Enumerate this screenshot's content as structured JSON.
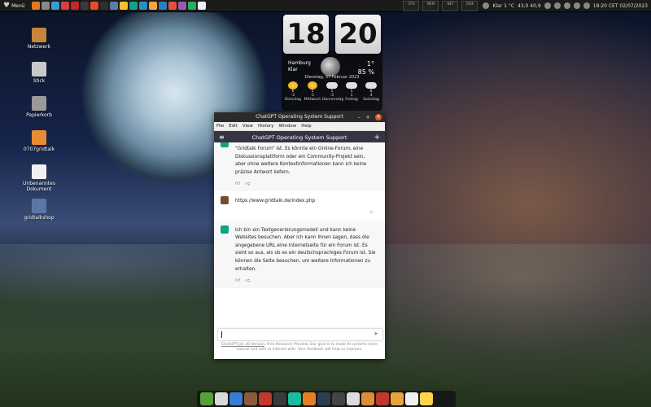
{
  "top_panel": {
    "menu_label": "Menü",
    "launcher_colors": [
      "#e07a23",
      "#888888",
      "#3a9ad9",
      "#d94040",
      "#c1272d",
      "#3a3a3a",
      "#e34b2a",
      "#303030",
      "#5b7fa6",
      "#f2c230",
      "#16a085",
      "#2c8fbf",
      "#f2a541",
      "#2980b9",
      "#e74c3c",
      "#9b59b6",
      "#27ae60",
      "#ecf0f1"
    ],
    "monitors": [
      "CPU",
      "MEM",
      "NET",
      "DISK"
    ],
    "weather": "Klar 1 °C",
    "keyboard": "43,0 40,9",
    "clock": "18:20 CET 02/07/2023"
  },
  "desktop_icons": [
    {
      "label": "Netzwerk",
      "color": "#c8843a"
    },
    {
      "label": "Stick",
      "color": "#c9c9c9"
    },
    {
      "label": "Papierkorb",
      "color": "#9a9a9a"
    },
    {
      "label": "0707gridtalk",
      "color": "#e88b34"
    },
    {
      "label": "Unbenanntes Dokument",
      "color": "#f1f1f1"
    },
    {
      "label": "gridtalkshop",
      "color": "#5a77a8"
    }
  ],
  "clock_widget": {
    "hour": "18",
    "minute": "20",
    "city": "Hamburg",
    "condition": "Klar",
    "temp": "1°",
    "humidity": "85 %",
    "date": "Dienstag, 07 Februar 2023",
    "forecast": [
      {
        "day": "Dienstag",
        "hi": "6",
        "lo": "-2",
        "icon": "sun"
      },
      {
        "day": "Mittwoch",
        "hi": "5",
        "lo": "-1",
        "icon": "sun"
      },
      {
        "day": "Donnerstag",
        "hi": "5",
        "lo": "-2",
        "icon": "cloud"
      },
      {
        "day": "Freitag",
        "hi": "5",
        "lo": "1",
        "icon": "cloud"
      },
      {
        "day": "Samstag",
        "hi": "8",
        "lo": "4",
        "icon": "cloud"
      }
    ]
  },
  "window": {
    "title": "ChatGPT Operating System Support",
    "menu": [
      "File",
      "Edit",
      "View",
      "History",
      "Window",
      "Help"
    ],
    "header_title": "ChatGPT Operating System Support",
    "messages": [
      {
        "role": "ai",
        "text": "\"Gridtalk Forum\" ist. Es könnte ein Online-Forum, eine Diskussionsplattform oder ein Community-Projekt sein, aber ohne weitere Kontextinformationen kann ich keine präzise Antwort liefern."
      },
      {
        "role": "user",
        "text": "https://www.gridtalk.de/index.php"
      },
      {
        "role": "ai",
        "text": "Ich bin ein Textgenerierungsmodell und kann keine Websites besuchen. Aber ich kann Ihnen sagen, dass die angegebene URL eine Internetseite für ein Forum ist. Es sieht so aus, als ob es ein deutschsprachiges Forum ist. Sie können die Seite besuchen, um weitere Informationen zu erhalten."
      }
    ],
    "footer_link": "ChatGPT Jan 30 Version",
    "footer_text": ". Free Research Preview. Our goal is to make AI systems more natural and safe to interact with. Your feedback will help us improve."
  },
  "dock_colors": [
    "#5a9e3a",
    "#d9d9d9",
    "#3a7bd5",
    "#8e5a3a",
    "#c0392b",
    "#3a3a3a",
    "#1abc9c",
    "#e67e22",
    "#2c3e50",
    "#444444",
    "#dcdcdc",
    "#e08a3a",
    "#c0392b",
    "#e8a33a",
    "#f0f0f0",
    "#ffd34a"
  ]
}
